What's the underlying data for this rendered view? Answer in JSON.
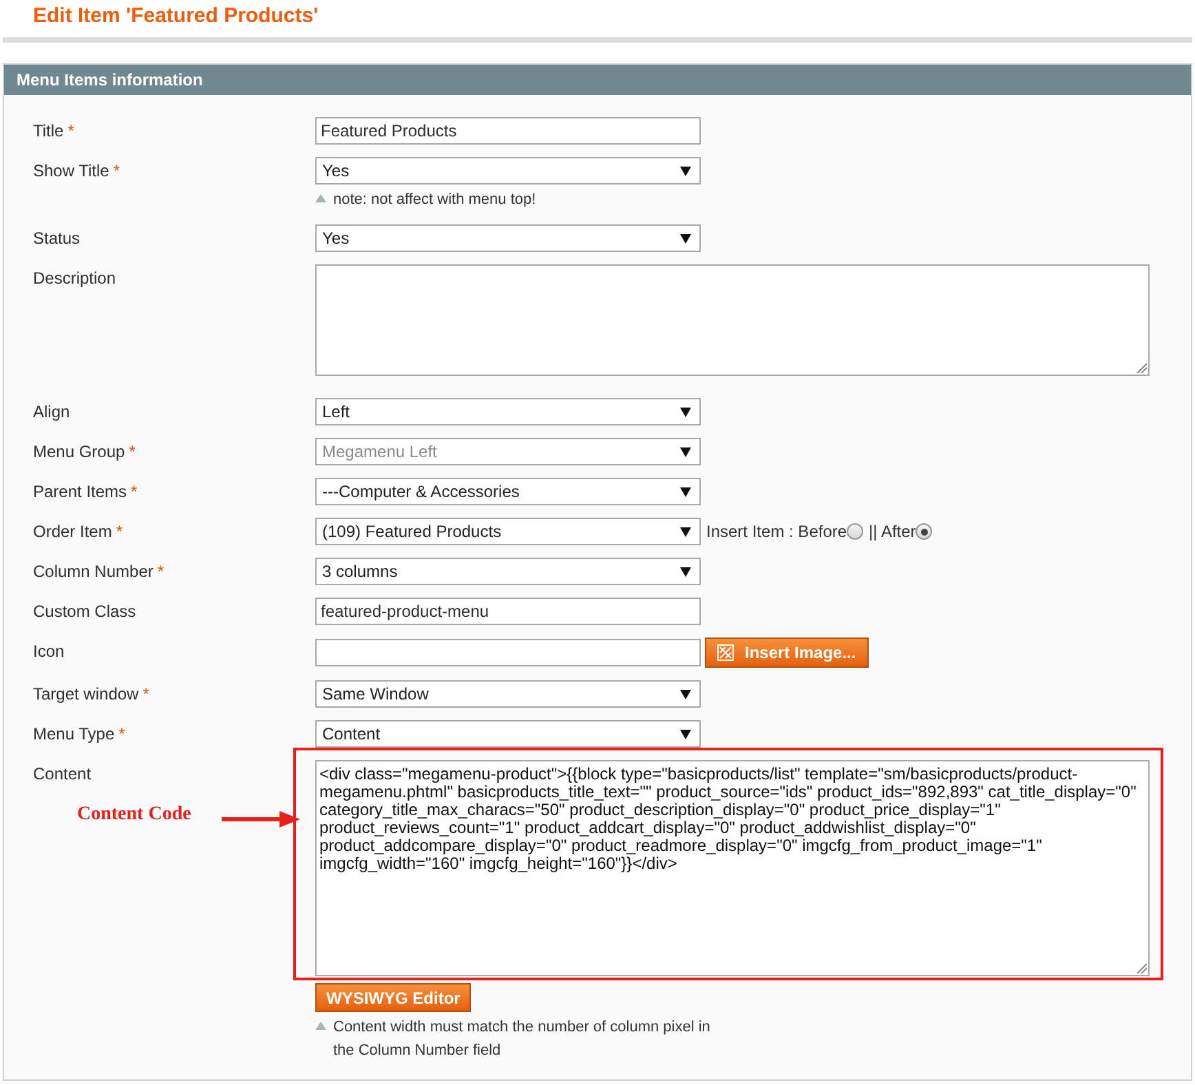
{
  "page_title": "Edit Item 'Featured Products'",
  "panel": {
    "title": "Menu Items information",
    "fields": [
      {
        "kind": "text",
        "label": "Title",
        "mark": "*",
        "value": "Featured Products"
      },
      {
        "kind": "select",
        "label": "Show Title",
        "mark": "*",
        "value": "Yes",
        "disabled": false,
        "note": "note: not affect with menu top!"
      },
      {
        "kind": "select",
        "label": "Status",
        "value": "Yes",
        "disabled": false
      },
      {
        "kind": "textarea",
        "label": "Description"
      },
      {
        "kind": "select",
        "label": "Align",
        "value": "Left",
        "disabled": false
      },
      {
        "kind": "select",
        "label": "Menu Group",
        "mark": "*",
        "value": "Megamenu Left",
        "disabled": true
      },
      {
        "kind": "select",
        "label": "Parent Items",
        "mark": "*",
        "value": "---Computer & Accessories",
        "disabled": false
      },
      {
        "kind": "select",
        "label": "Order Item",
        "mark": "*",
        "value": "(109) Featured Products",
        "disabled": false,
        "radios": [
          {
            "label": "Insert Item : Before",
            "selected": false
          },
          {
            "label": "|| After",
            "selected": true
          }
        ]
      },
      {
        "kind": "select",
        "label": "Column Number",
        "mark": "*",
        "value": "3 columns",
        "disabled": false
      },
      {
        "kind": "text",
        "label": "Custom Class",
        "value": "featured-product-menu"
      },
      {
        "kind": "image",
        "label": "Icon",
        "button": "Insert Image..."
      },
      {
        "kind": "select",
        "label": "Target window",
        "mark": "*",
        "value": "Same Window",
        "disabled": false
      },
      {
        "kind": "select",
        "label": "Menu Type",
        "mark": "*",
        "value": "Content",
        "disabled": false
      },
      {
        "kind": "content",
        "label": "Content",
        "value": "<div class=\"megamenu-product\">{{block type=\"basicproducts/list\" template=\"sm/basicproducts/product-megamenu.phtml\" basicproducts_title_text=\"\" product_source=\"ids\" product_ids=\"892,893\" cat_title_display=\"0\" category_title_max_characs=\"50\" product_description_display=\"0\" product_price_display=\"1\" product_reviews_count=\"1\" product_addcart_display=\"0\" product_addwishlist_display=\"0\" product_addcompare_display=\"0\" product_readmore_display=\"0\" imgcfg_from_product_image=\"1\" imgcfg_width=\"160\" imgcfg_height=\"160\"}}</div>",
        "button": "WYSIWYG Editor",
        "note": "Content width must match the number of column pixel in the Column Number field",
        "annotation": "Content Code"
      }
    ]
  }
}
